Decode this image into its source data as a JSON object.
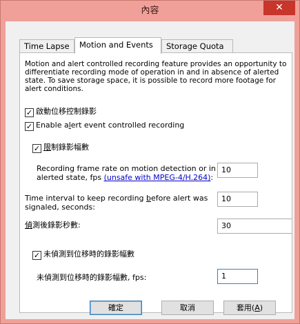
{
  "window": {
    "title": "內容",
    "close_glyph": "✕"
  },
  "tabs": [
    {
      "label": "Time Lapse"
    },
    {
      "label": "Motion and Events"
    },
    {
      "label": "Storage Quota"
    }
  ],
  "description": "Motion and alert controlled recording feature provides an opportunity to differentiate recording mode of operation in and in absence of alerted state. To save storage space, it is possible to record more footage for alert conditions.",
  "checkboxes": {
    "motion_control": {
      "label": "啟動位移控制錄影",
      "checked": true
    },
    "alert_event": {
      "label_before": "Enable a",
      "label_underlined": "l",
      "label_after": "ert event controlled recording",
      "checked": true
    },
    "limit_frames": {
      "label_before": "限",
      "label_after": "制錄影幅數",
      "checked": true
    },
    "no_motion_frames": {
      "label": "未偵測到位移時的錄影幅數",
      "checked": true
    }
  },
  "fields": {
    "motion_rate": {
      "label_line1": "Recording frame rate on motion detection or in",
      "label_line2": "alerted state, fps ",
      "link": "(unsafe with MPEG-4/H.264)",
      "label_suffix": ":",
      "value": "10"
    },
    "before_alert": {
      "label_line1_before": "Time interval to keep recording ",
      "label_line1_underlined": "b",
      "label_line1_after": "efore alert was",
      "label_line2": "signaled, seconds:",
      "value": "10"
    },
    "after_detect": {
      "label_before": "",
      "label_underlined": "偵",
      "label_after": "測後錄影秒數:",
      "value": "30"
    },
    "no_motion_rate": {
      "label": "未偵測到位移時的錄影幅數, fps:",
      "value": "1"
    }
  },
  "buttons": {
    "ok": "確定",
    "cancel": "取消",
    "apply_before": "套用(",
    "apply_underlined": "A",
    "apply_after": ")"
  }
}
